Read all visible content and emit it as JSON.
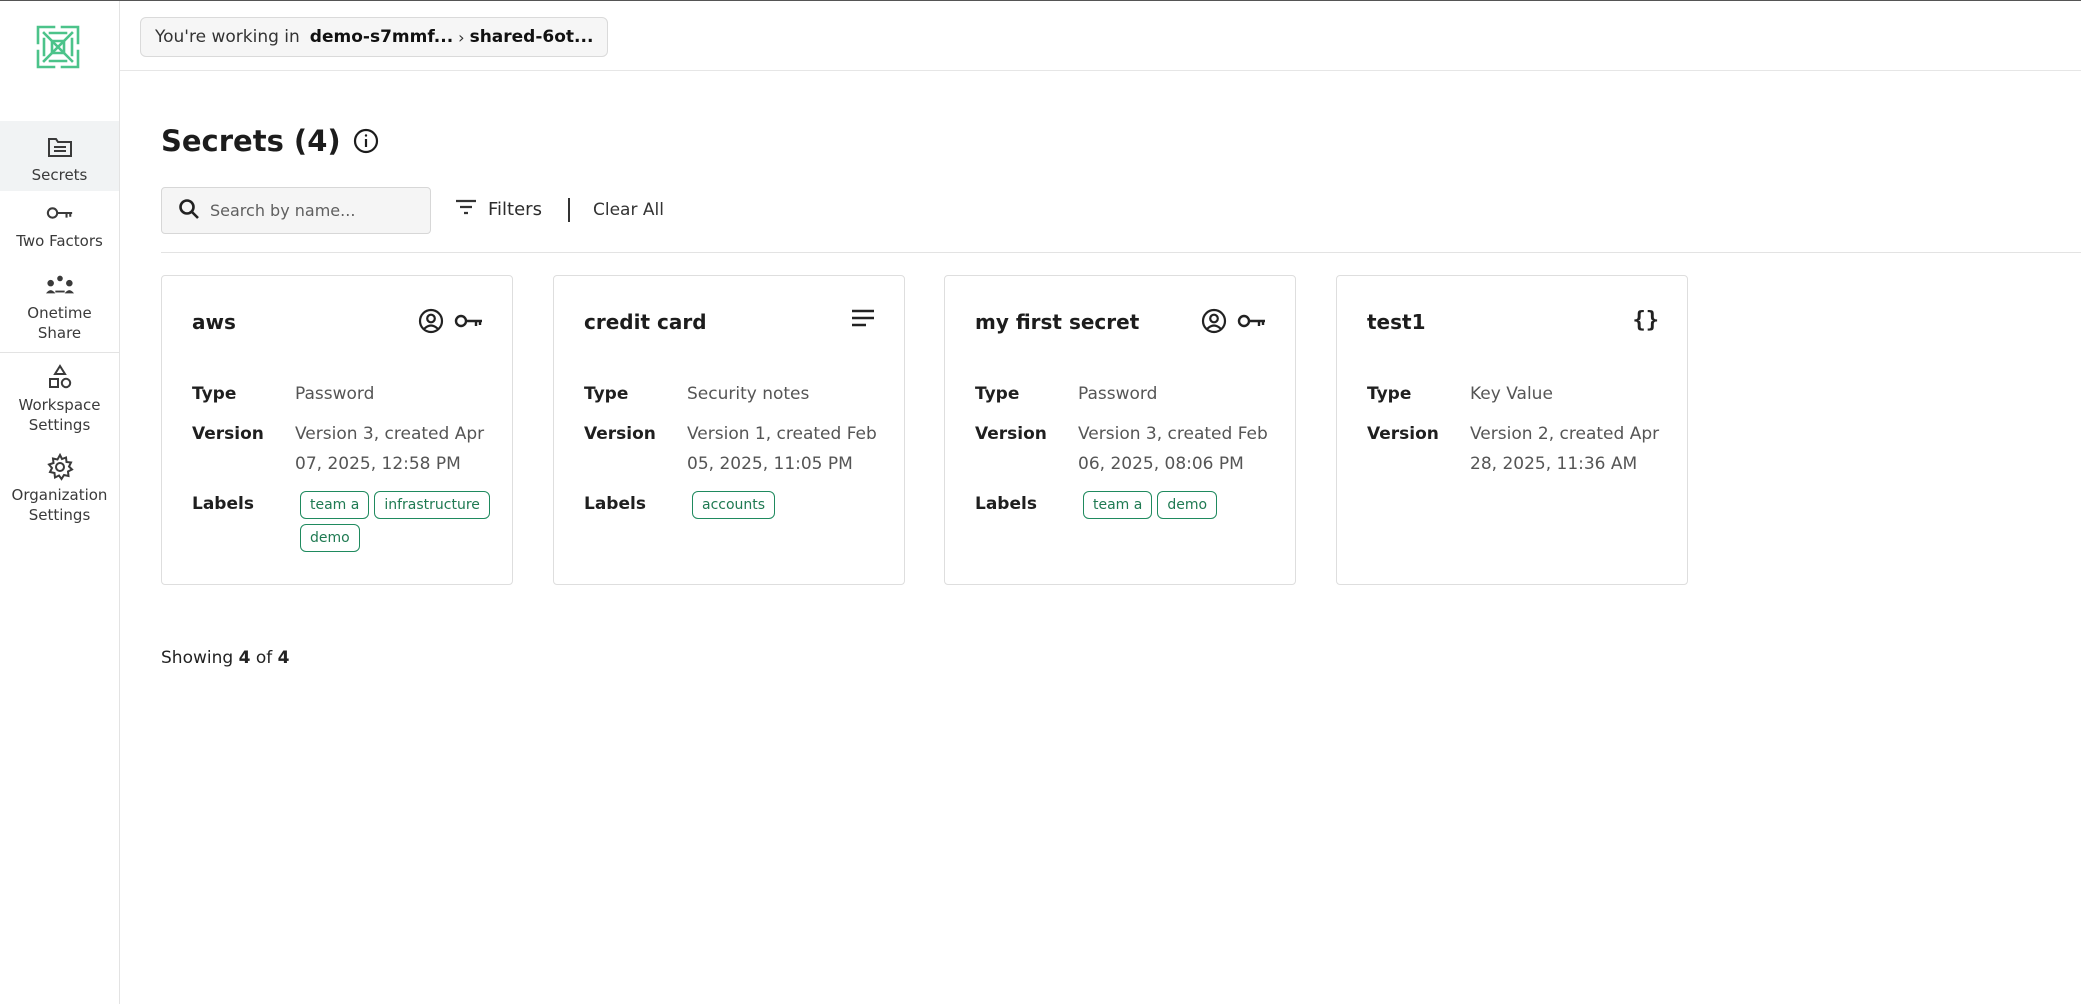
{
  "sidebar": {
    "items": [
      {
        "label": "Secrets",
        "icon": "folder-icon"
      },
      {
        "label": "Two Factors",
        "icon": "key-icon"
      },
      {
        "label": "Onetime Share",
        "icon": "share-nodes-icon"
      },
      {
        "label": "Workspace Settings",
        "icon": "shapes-icon"
      },
      {
        "label": "Organization Settings",
        "icon": "gear-icon"
      }
    ]
  },
  "topbar": {
    "prefix": "You're working in",
    "crumbs": [
      "demo-s7mmf...",
      "shared-6ot..."
    ]
  },
  "main": {
    "title": "Secrets (4)",
    "search_placeholder": "Search by name...",
    "filters_label": "Filters",
    "clear_all_label": "Clear All",
    "showing": {
      "prefix": "Showing",
      "count": "4",
      "of": "of",
      "total": "4"
    }
  },
  "fields": {
    "type": "Type",
    "version": "Version",
    "labels": "Labels"
  },
  "cards": [
    {
      "title": "aws",
      "type": "Password",
      "version": "Version 3, created Apr 07, 2025, 12:58 PM",
      "labels": [
        "team a",
        "infrastructure",
        "demo"
      ],
      "icons": [
        "user-circle-icon",
        "key-icon"
      ]
    },
    {
      "title": "credit card",
      "type": "Security notes",
      "version": "Version 1, created Feb 05, 2025, 11:05 PM",
      "labels": [
        "accounts"
      ],
      "icons": [
        "notes-lines-icon"
      ]
    },
    {
      "title": "my first secret",
      "type": "Password",
      "version": "Version 3, created Feb 06, 2025, 08:06 PM",
      "labels": [
        "team a",
        "demo"
      ],
      "icons": [
        "user-circle-icon",
        "key-icon"
      ]
    },
    {
      "title": "test1",
      "type": "Key Value",
      "version": "Version 2, created Apr 28, 2025, 11:36 AM",
      "labels": [],
      "icons": [
        "curly-braces-icon"
      ]
    }
  ],
  "colors": {
    "accent": "#1f8a5e",
    "logo": "#4cc38a"
  }
}
